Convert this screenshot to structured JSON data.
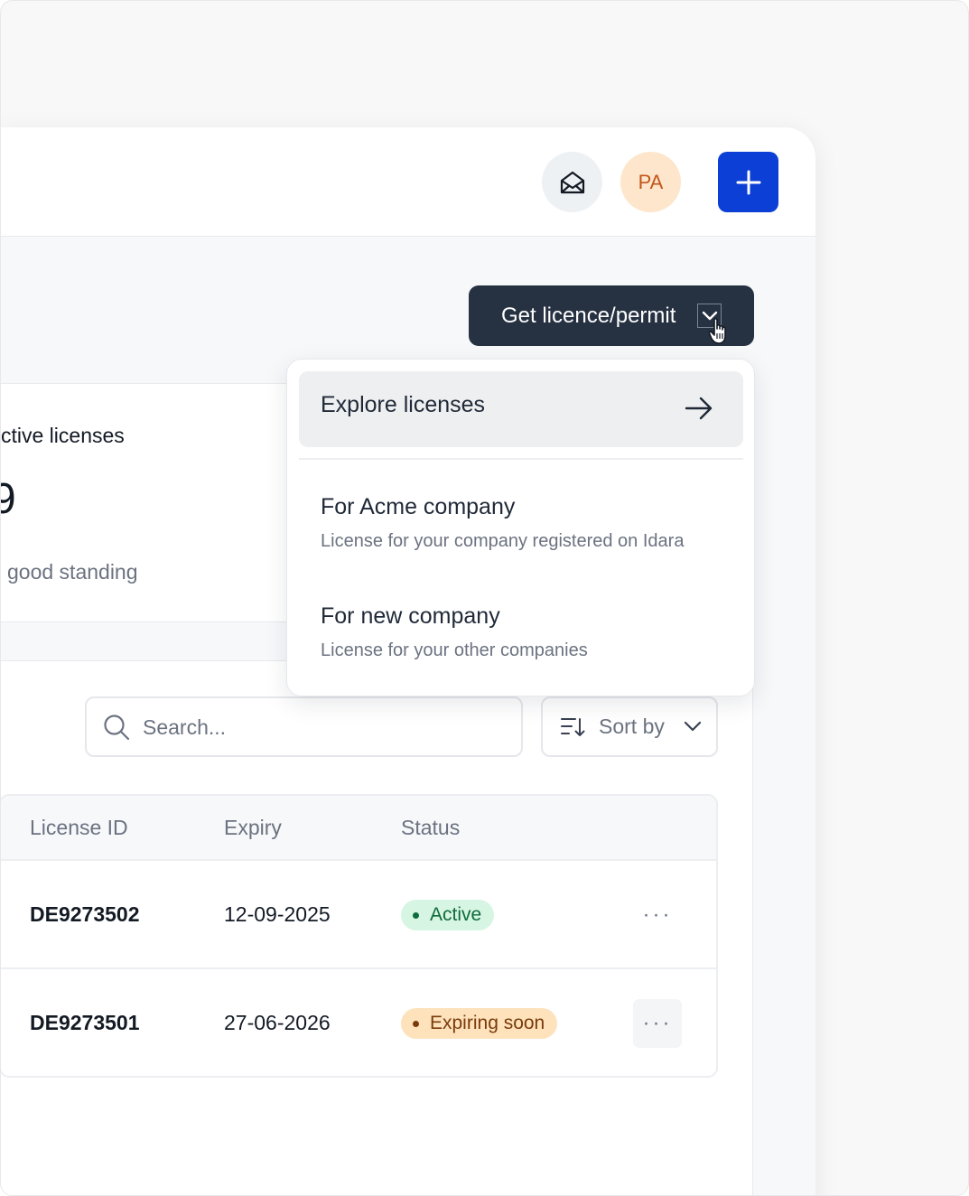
{
  "header": {
    "mail_icon": "envelope-open-icon",
    "avatar_initials": "PA",
    "add_icon": "plus-icon"
  },
  "get_licence": {
    "label": "Get licence/permit",
    "icon": "chevron-down-icon"
  },
  "summary_card": {
    "title": "ctive licenses",
    "value": "9",
    "subtitle": "good standing"
  },
  "dropdown": {
    "explore_label": "Explore licenses",
    "items": [
      {
        "title": "For Acme company",
        "subtitle": "License for your company registered on Idara"
      },
      {
        "title": "For new company",
        "subtitle": "License for your other companies"
      }
    ]
  },
  "search": {
    "placeholder": "Search..."
  },
  "sort": {
    "label": "Sort by"
  },
  "table": {
    "columns": [
      "License ID",
      "Expiry",
      "Status"
    ],
    "rows": [
      {
        "id": "DE9273502",
        "expiry": "12-09-2025",
        "status": "Active"
      },
      {
        "id": "DE9273501",
        "expiry": "27-06-2026",
        "status": "Expiring soon"
      }
    ],
    "more_label": "···"
  },
  "colors": {
    "primary": "#0b3fd6",
    "dark_button": "#263142",
    "active_badge": "#d7f5e3",
    "expiring_badge": "#fde2bb"
  }
}
